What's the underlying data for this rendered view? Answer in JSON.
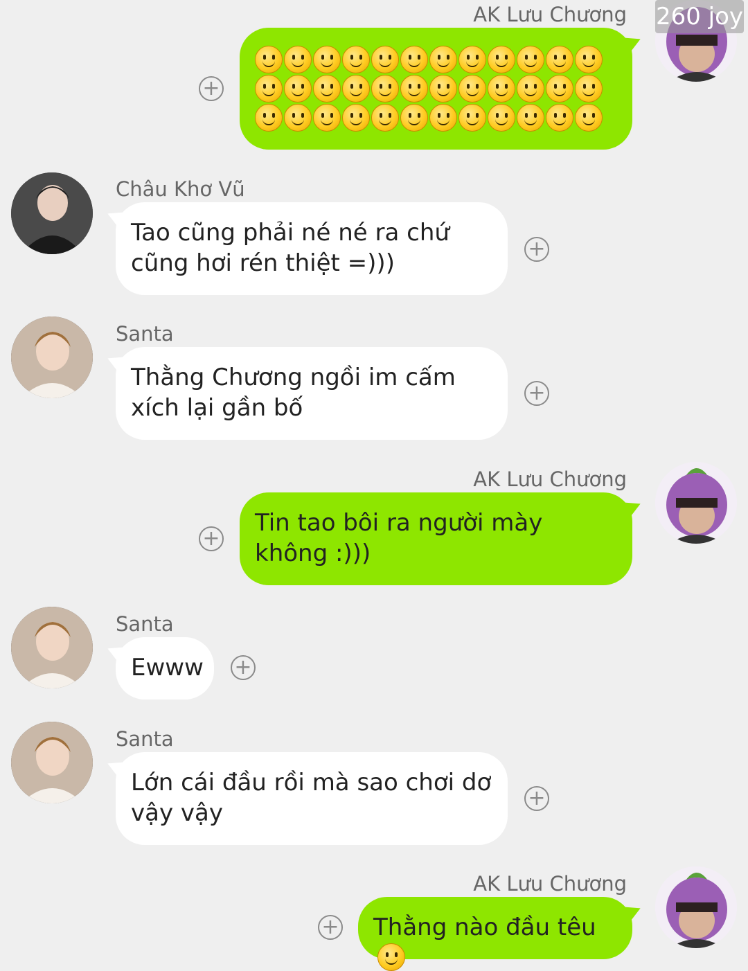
{
  "watermark": "260 joy",
  "icons": {
    "add": "plus-circle-icon",
    "emoji": "smiling-face-icon"
  },
  "colors": {
    "background": "#efefef",
    "outgoing_bubble": "#8ee600",
    "incoming_bubble": "#ffffff"
  },
  "messages": [
    {
      "direction": "outgoing",
      "sender": "AK Lưu Chương",
      "text": "",
      "emoji_count": 36,
      "emoji": "smiling-face"
    },
    {
      "direction": "incoming",
      "sender": "Châu Khơ Vũ",
      "text": "Tao cũng phải né né ra chứ cũng hơi rén thiệt =)))"
    },
    {
      "direction": "incoming",
      "sender": "Santa",
      "text": "Thằng Chương ngồi im cấm xích lại gần bố"
    },
    {
      "direction": "outgoing",
      "sender": "AK Lưu Chương",
      "text": "Tin tao bôi ra người mày không :)))"
    },
    {
      "direction": "incoming",
      "sender": "Santa",
      "text": "Ewww"
    },
    {
      "direction": "incoming",
      "sender": "Santa",
      "text": "Lớn cái đầu rồi mà sao chơi dơ vậy vậy"
    },
    {
      "direction": "outgoing",
      "sender": "AK Lưu Chương",
      "text": "Thằng nào đầu têu",
      "trailing_emoji": "smiling-face"
    }
  ]
}
